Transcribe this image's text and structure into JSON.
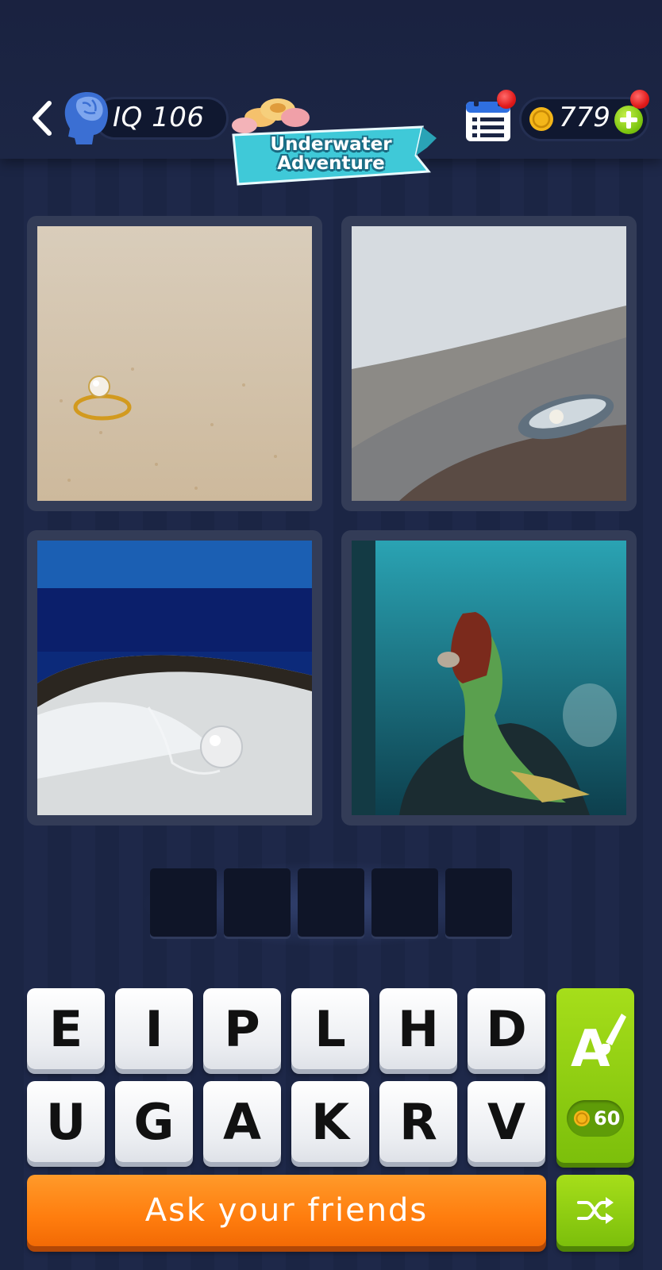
{
  "header": {
    "iq_label": "IQ 106",
    "coins": "779",
    "banner_title": "Underwater Adventure",
    "icons": [
      "back-arrow-icon",
      "brain-head-icon",
      "calendar-icon",
      "coin-icon",
      "plus-icon"
    ]
  },
  "puzzle": {
    "images": [
      {
        "name": "pearl-ring-on-sand"
      },
      {
        "name": "oyster-with-pearl-on-rock"
      },
      {
        "name": "pearl-splash-in-shell"
      },
      {
        "name": "mermaid-holding-shell"
      }
    ],
    "answer_slots": [
      "",
      "",
      "",
      "",
      ""
    ]
  },
  "keyboard": {
    "row1": [
      "E",
      "I",
      "P",
      "L",
      "H",
      "D"
    ],
    "row2": [
      "U",
      "G",
      "A",
      "K",
      "R",
      "V"
    ]
  },
  "hint": {
    "cost": "60",
    "icon": "paint-letter-icon"
  },
  "actions": {
    "ask_label": "Ask your friends",
    "shuffle_icon": "shuffle-icon"
  },
  "colors": {
    "background": "#1a2340",
    "accent_orange": "#ff7d0e",
    "accent_green": "#8fd014",
    "banner_teal": "#3fc9d8"
  }
}
